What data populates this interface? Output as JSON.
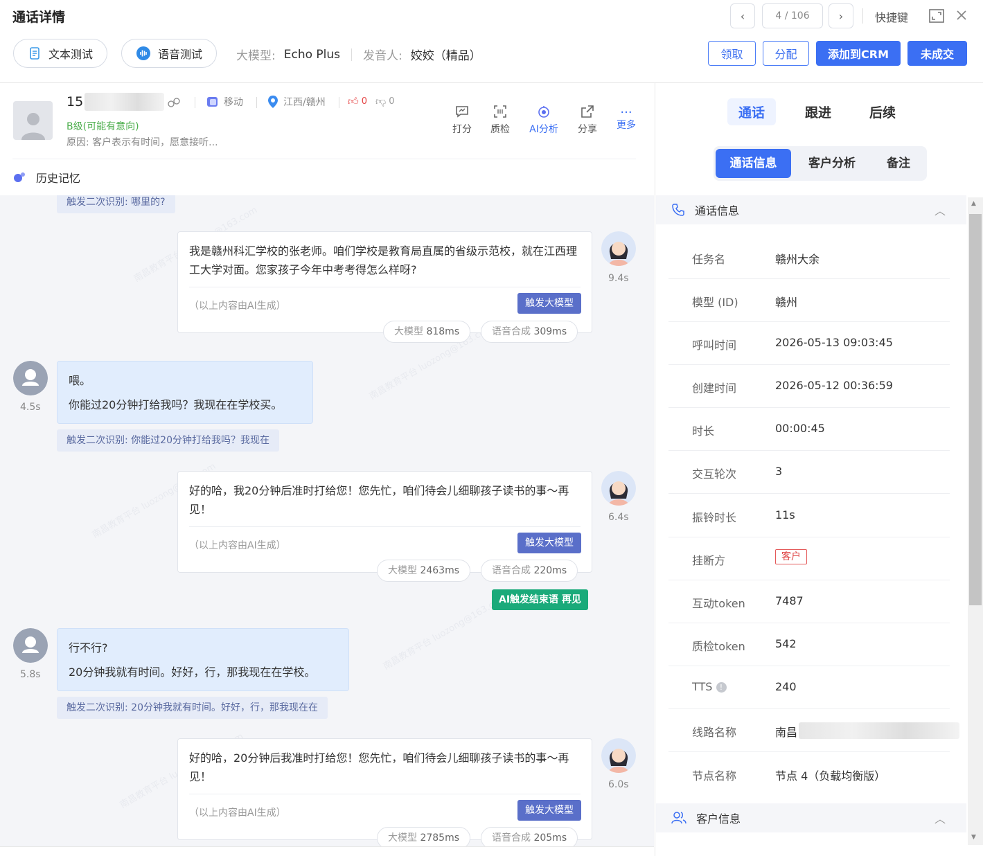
{
  "header": {
    "title": "通话详情",
    "pager": "4 / 106",
    "shortcut_label": "快捷键",
    "text_test": "文本测试",
    "voice_test": "语音测试",
    "model_label": "大模型:",
    "model_value": "Echo Plus",
    "speaker_label": "发音人:",
    "speaker_value": "姣姣（精品）",
    "btn_claim": "领取",
    "btn_assign": "分配",
    "btn_crm": "添加到CRM",
    "btn_not_deal": "未成交"
  },
  "customer": {
    "phone_prefix": "15",
    "carrier": "移动",
    "region": "江西/赣州",
    "likes": "0",
    "dislikes": "0",
    "level": "B级(可能有意向)",
    "reason": "原因: 客户表示有时间，愿意接听..."
  },
  "tools": [
    {
      "label": "打分",
      "icon": "comment-icon"
    },
    {
      "label": "质检",
      "icon": "scan-icon"
    },
    {
      "label": "AI分析",
      "icon": "ai-analysis-icon"
    },
    {
      "label": "分享",
      "icon": "share-icon"
    },
    {
      "label": "更多",
      "icon": "more-icon"
    }
  ],
  "history_label": "历史记忆",
  "chat": {
    "trigger_top": "触发二次识别: 哪里的?",
    "ai_note": "（以上内容由AI生成）",
    "llm_btn": "触发大模型",
    "llm_key": "大模型",
    "tts_key": "语音合成",
    "bot1": {
      "text": "我是赣州科汇学校的张老师。咱们学校是教育局直属的省级示范校，就在江西理工大学对面。您家孩子今年中考考得怎么样呀?",
      "time": "9.4s",
      "llm": "818ms",
      "tts": "309ms"
    },
    "user1": {
      "line1": "喂。",
      "line2": "你能过20分钟打给我吗？我现在在学校买。",
      "time": "4.5s",
      "trigger": "触发二次识别: 你能过20分钟打给我吗？我现在"
    },
    "bot2": {
      "text": "好的哈，我20分钟后准时打给您！您先忙，咱们待会儿细聊孩子读书的事～再见！",
      "time": "6.4s",
      "llm": "2463ms",
      "tts": "220ms",
      "end_tag": "AI触发结束语 再见"
    },
    "user2": {
      "line1": "行不行?",
      "line2": "20分钟我就有时间。好好，行，那我现在在学校。",
      "time": "5.8s",
      "trigger": "触发二次识别: 20分钟我就有时间。好好，行，那我现在在"
    },
    "bot3": {
      "text": "好的哈，20分钟后我准时打给您！您先忙，咱们待会儿细聊孩子读书的事～再见！",
      "time": "6.0s",
      "llm": "2785ms",
      "tts": "205ms"
    }
  },
  "right": {
    "tabs": [
      "通话",
      "跟进",
      "后续"
    ],
    "segments": [
      "通话信息",
      "客户分析",
      "备注"
    ],
    "section_call": "通话信息",
    "section_customer": "客户信息",
    "rows": [
      {
        "k": "任务名",
        "v": "赣州大余"
      },
      {
        "k": "模型 (ID)",
        "v": "赣州"
      },
      {
        "k": "呼叫时间",
        "v": "2026-05-13 09:03:45"
      },
      {
        "k": "创建时间",
        "v": "2026-05-12 00:36:59"
      },
      {
        "k": "时长",
        "v": "00:00:45"
      },
      {
        "k": "交互轮次",
        "v": "3"
      },
      {
        "k": "振铃时长",
        "v": "11s"
      },
      {
        "k": "挂断方",
        "v": "客户"
      },
      {
        "k": "互动token",
        "v": "7487"
      },
      {
        "k": "质检token",
        "v": "542"
      },
      {
        "k": "TTS",
        "v": "240"
      },
      {
        "k": "线路名称",
        "v": "南昌",
        "v_end": "6"
      },
      {
        "k": "节点名称",
        "v": "节点 4（负载均衡版）"
      }
    ]
  },
  "colors": {
    "primary": "#3b6ff3",
    "green": "#1aaa7a",
    "trigger_bg": "#e6ebf7",
    "user_bubble": "#e1edfd"
  }
}
